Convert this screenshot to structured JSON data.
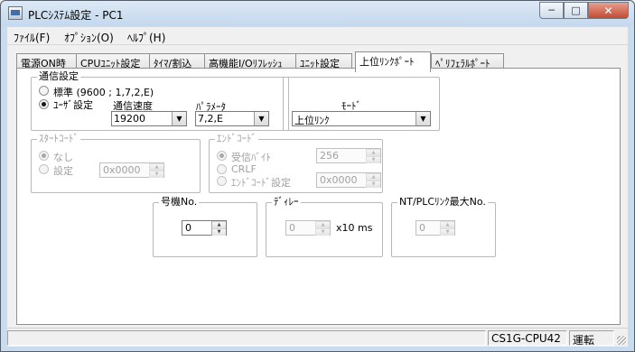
{
  "window": {
    "title": "PLCｼｽﾃﾑ設定 - PC1"
  },
  "menu": [
    "ﾌｧｲﾙ(F)",
    "ｵﾌﾟｼｮﾝ(O)",
    "ﾍﾙﾌﾟ(H)"
  ],
  "tabs": [
    "電源ON時",
    "CPUﾕﾆｯﾄ設定",
    "ﾀｲﾏ/割込",
    "高機能I/Oﾘﾌﾚｯｼｭ",
    "ﾕﾆｯﾄ設定",
    "上位ﾘﾝｸﾎﾟｰﾄ",
    "ﾍﾟﾘﾌｪﾗﾙﾎﾟｰﾄ"
  ],
  "active_tab": "上位ﾘﾝｸﾎﾟｰﾄ",
  "comm": {
    "legend": "通信設定",
    "standard_label": "標準 (9600 ; 1,7,2,E)",
    "user_label": "ﾕｰｻﾞ設定",
    "speed_label": "通信速度",
    "speed_value": "19200",
    "param_label": "ﾊﾟﾗﾒｰﾀ",
    "param_value": "7,2,E"
  },
  "mode": {
    "label": "ﾓｰﾄﾞ",
    "value": "上位ﾘﾝｸ"
  },
  "start_code": {
    "legend": "ｽﾀｰﾄｺｰﾄﾞ",
    "none_label": "なし",
    "set_label": "設定",
    "value": "0x0000"
  },
  "end_code": {
    "legend": "ｴﾝﾄﾞｺｰﾄﾞ",
    "recv_label": "受信ﾊﾞｲﾄ",
    "recv_value": "256",
    "crlf_label": "CRLF",
    "set_label": "ｴﾝﾄﾞｺｰﾄﾞ設定",
    "set_value": "0x0000"
  },
  "unit_no": {
    "legend": "号機No.",
    "value": "0"
  },
  "delay": {
    "legend": "ﾃﾞｨﾚｰ",
    "value": "0",
    "unit": "x10 ms"
  },
  "nt_max": {
    "legend": "NT/PLCﾘﾝｸ最大No.",
    "value": "0"
  },
  "status": {
    "model": "CS1G-CPU42",
    "state": "運転"
  }
}
